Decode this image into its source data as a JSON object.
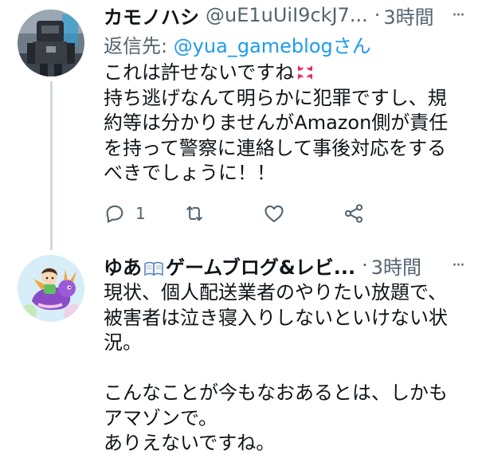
{
  "tweets": [
    {
      "name": "カモノハシ",
      "handle": "@uE1uUiI9ckJ7...",
      "dot": "·",
      "time": "3時間",
      "more": "···",
      "reply_prefix": "返信先: ",
      "reply_mention": "@yua_gameblog",
      "reply_suffix": "さん",
      "body_first_line": "これは許せないですね",
      "body_rest": "持ち逃げなんて明らかに犯罪ですし、規\n約等は分かりませんがAmazon側が責任\nを持って警察に連絡して事後対応をする\nべきでしょうに！！",
      "reply_count": "1",
      "avatar_icon": "robot-figure-avatar",
      "inline_emoji": "anger-symbol-icon"
    },
    {
      "name_part1": "ゆあ",
      "name_part2": "ゲームブログ&レビ...",
      "dot": "·",
      "time": "3時間",
      "more": "···",
      "body": "現状、個人配送業者のやりたい放題で、\n被害者は泣き寝入りしないといけない状\n況。\n\nこんなことが今もなおあるとは、しかも\nアマゾンで。\nありえないですね。",
      "avatar_icon": "purple-dragon-avatar",
      "inline_emoji": "open-book-icon"
    }
  ],
  "colors": {
    "text": "#0f1419",
    "muted": "#536471",
    "link": "#1d9bf0",
    "thread_line": "#cfd9de",
    "anger": "#f4245e"
  }
}
